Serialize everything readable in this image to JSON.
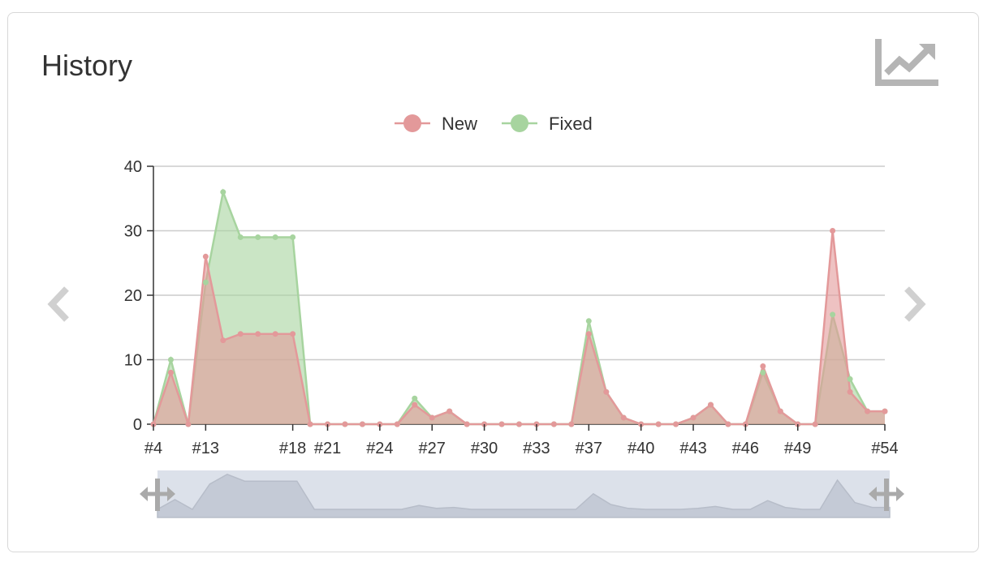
{
  "header": {
    "title": "History"
  },
  "icons": {
    "header_icon": "trending-up-icon",
    "prev": "chevron-left-icon",
    "next": "chevron-right-icon",
    "zoom_left": "resize-handle-icon",
    "zoom_right": "resize-handle-icon"
  },
  "colors": {
    "new": "#e3999a",
    "fixed": "#a7d49f",
    "grid": "#cccccc",
    "axis_text": "#333333",
    "zoom_bg": "#dce1ea"
  },
  "chart_data": {
    "type": "area",
    "legend": [
      "New",
      "Fixed"
    ],
    "legend_position": "top-center",
    "grid": true,
    "x": [
      "#4",
      "#5",
      "#6",
      "#13",
      "#14",
      "#15",
      "#16",
      "#17",
      "#18",
      "#19",
      "#21",
      "#22",
      "#23",
      "#24",
      "#25",
      "#26",
      "#27",
      "#28",
      "#29",
      "#30",
      "#31",
      "#32",
      "#33",
      "#34",
      "#35",
      "#37",
      "#38",
      "#39",
      "#40",
      "#41",
      "#42",
      "#43",
      "#44",
      "#45",
      "#46",
      "#47",
      "#48",
      "#49",
      "#50",
      "#51",
      "#52",
      "#53",
      "#54"
    ],
    "x_tick_labels": [
      "#4",
      "#13",
      "#18",
      "#21",
      "#24",
      "#27",
      "#30",
      "#33",
      "#37",
      "#40",
      "#43",
      "#46",
      "#49",
      "#54"
    ],
    "ylim": [
      0,
      40
    ],
    "y_ticks": [
      0,
      10,
      20,
      30,
      40
    ],
    "series": [
      {
        "name": "New",
        "values": [
          0,
          8,
          0,
          26,
          13,
          14,
          14,
          14,
          14,
          0,
          0,
          0,
          0,
          0,
          0,
          3,
          1,
          2,
          0,
          0,
          0,
          0,
          0,
          0,
          0,
          14,
          5,
          1,
          0,
          0,
          0,
          1,
          3,
          0,
          0,
          9,
          2,
          0,
          0,
          30,
          5,
          2,
          2
        ]
      },
      {
        "name": "Fixed",
        "values": [
          0,
          10,
          0,
          22,
          36,
          29,
          29,
          29,
          29,
          0,
          0,
          0,
          0,
          0,
          0,
          4,
          1,
          2,
          0,
          0,
          0,
          0,
          0,
          0,
          0,
          16,
          5,
          1,
          0,
          0,
          0,
          1,
          3,
          0,
          0,
          8,
          2,
          0,
          0,
          17,
          7,
          2,
          2
        ]
      }
    ]
  }
}
